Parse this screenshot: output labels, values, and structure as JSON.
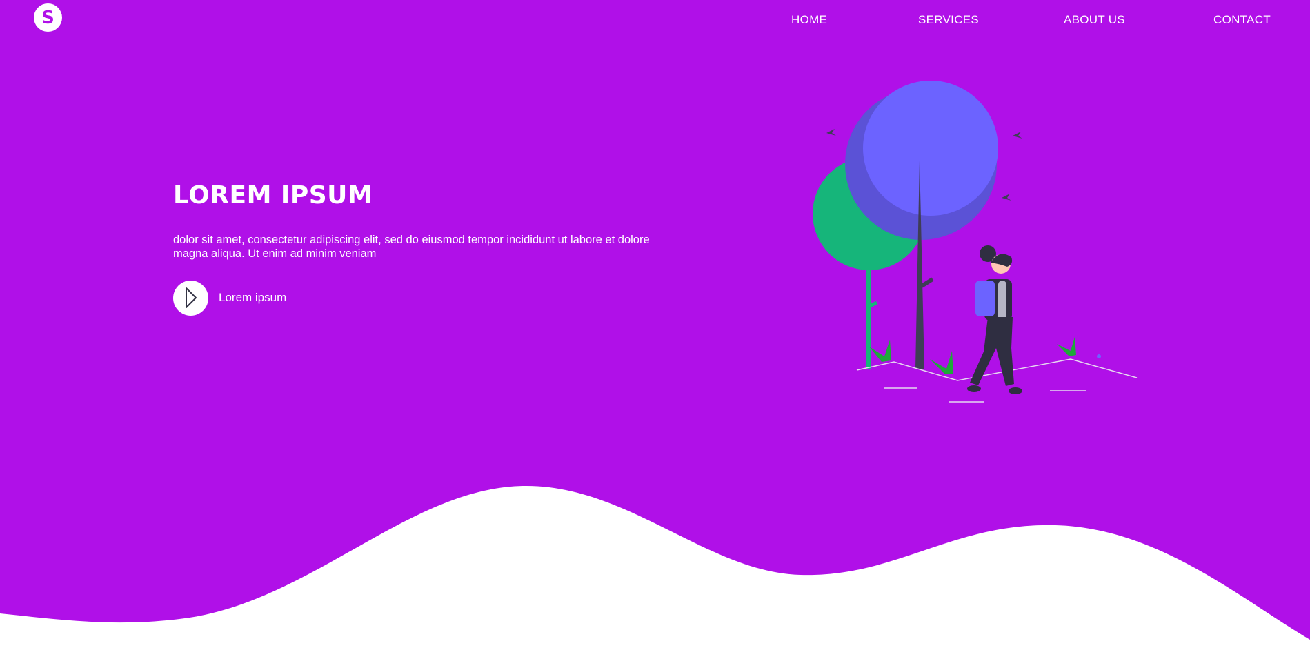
{
  "colors": {
    "brand": "#b010e8",
    "background": "#ffffff",
    "text": "#ffffff",
    "tree_purple": "#6c63ff",
    "tree_green": "#16b57a"
  },
  "logo": {
    "letter": "S"
  },
  "nav": {
    "items": [
      {
        "label": "HOME"
      },
      {
        "label": "SERVICES"
      },
      {
        "label": "ABOUT US"
      },
      {
        "label": "CONTACT"
      }
    ]
  },
  "hero": {
    "title": "LOREM IPSUM",
    "text": "dolor sit amet, consectetur adipiscing elit, sed do eiusmod tempor incididunt ut labore et dolore magna aliqua. Ut enim ad minim veniam",
    "cta_label": "Lorem ipsum",
    "cta_icon": "play-icon"
  },
  "illustration": {
    "icon": "hiker-with-trees-illustration"
  }
}
